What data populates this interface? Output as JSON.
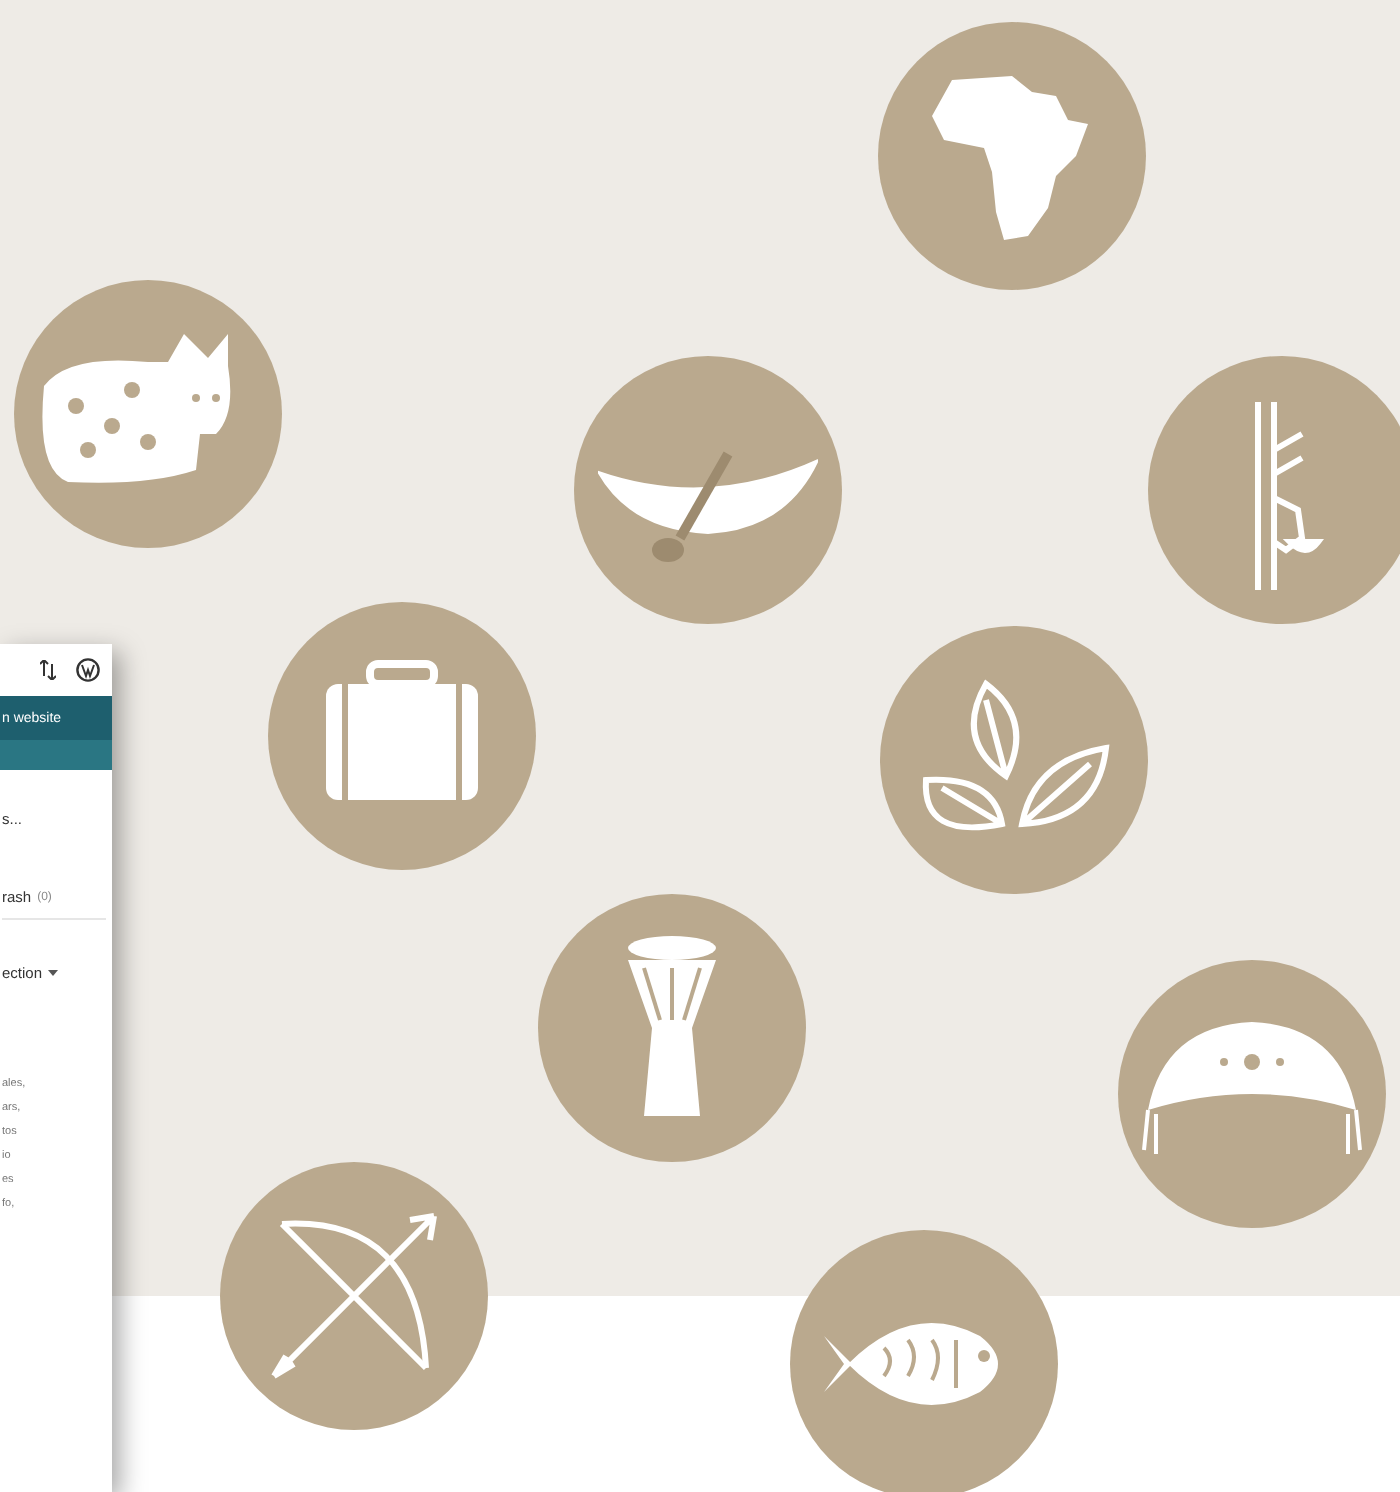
{
  "admin_preview": {
    "header_title": "n website",
    "lines": [
      {
        "kind": "plain",
        "text": "s..."
      },
      {
        "kind": "count",
        "text": "rash",
        "count": "(0)"
      },
      {
        "kind": "dropdown",
        "text": "ection"
      },
      {
        "kind": "small",
        "text": "ales,"
      },
      {
        "kind": "small",
        "text": "ars,"
      },
      {
        "kind": "small",
        "text": "tos"
      },
      {
        "kind": "small",
        "text": "io"
      },
      {
        "kind": "small",
        "text": "es"
      },
      {
        "kind": "small",
        "text": "fo,"
      }
    ]
  }
}
